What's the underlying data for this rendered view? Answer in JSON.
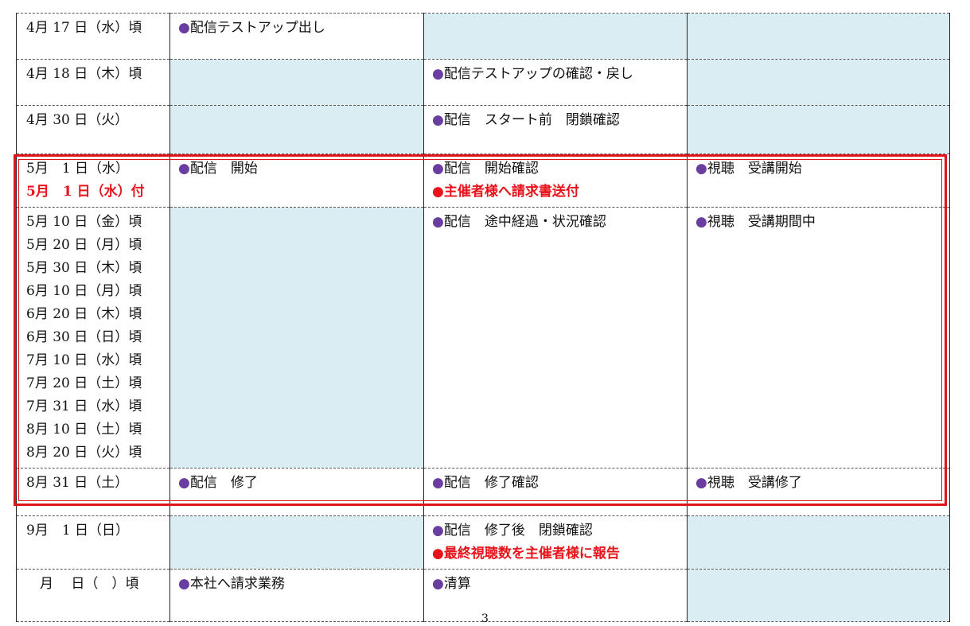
{
  "bullet_glyph": "●",
  "rows": [
    {
      "date": [
        "4月 17 日（水）頃"
      ],
      "c1": [
        {
          "t": "配信テストアップ出し"
        }
      ],
      "c2": [],
      "c3": [],
      "shade": [
        false,
        true,
        true
      ]
    },
    {
      "date": [
        "4月 18 日（木）頃"
      ],
      "c1": [],
      "c2": [
        {
          "t": "配信テストアップの確認・戻し"
        }
      ],
      "c3": [],
      "shade": [
        true,
        false,
        true
      ]
    },
    {
      "date": [
        "4月 30 日（火）"
      ],
      "c1": [],
      "c2": [
        {
          "t": "配信　スタート前　閉鎖確認"
        }
      ],
      "c3": [],
      "shade": [
        true,
        false,
        true
      ]
    },
    {
      "date": [
        "5月　1 日（水）",
        {
          "t": "5月　1 日（水）付",
          "red": true
        }
      ],
      "c1": [
        {
          "t": "配信　開始"
        }
      ],
      "c2": [
        {
          "t": "配信　開始確認"
        },
        {
          "t": "主催者様へ請求書送付",
          "red": true
        }
      ],
      "c3": [
        {
          "t": "視聴　受講開始"
        }
      ],
      "shade": [
        false,
        false,
        false
      ]
    },
    {
      "date": [
        "5月 10 日（金）頃",
        "5月 20 日（月）頃",
        "5月 30 日（木）頃",
        "6月 10 日（月）頃",
        "6月 20 日（木）頃",
        "6月 30 日（日）頃",
        "7月 10 日（水）頃",
        "7月 20 日（土）頃",
        "7月 31 日（水）頃",
        "8月 10 日（土）頃",
        "8月 20 日（火）頃"
      ],
      "c1": [],
      "c2": [
        {
          "t": "配信　途中経過・状況確認"
        }
      ],
      "c3": [
        {
          "t": "視聴　受講期間中"
        }
      ],
      "shade": [
        true,
        false,
        false
      ]
    },
    {
      "date": [
        "8月 31 日（土）"
      ],
      "c1": [
        {
          "t": "配信　修了"
        }
      ],
      "c2": [
        {
          "t": "配信　修了確認"
        }
      ],
      "c3": [
        {
          "t": "視聴　受講修了"
        }
      ],
      "shade": [
        false,
        false,
        false
      ]
    },
    {
      "date": [
        "9月　1 日（日）"
      ],
      "c1": [],
      "c2": [
        {
          "t": "配信　修了後　閉鎖確認"
        },
        {
          "t": "最終視聴数を主催者様に報告",
          "red": true
        }
      ],
      "c3": [],
      "shade": [
        true,
        false,
        true
      ]
    },
    {
      "date": [
        "　月　 日（　）頃"
      ],
      "c1": [
        {
          "t": "本社へ請求業務"
        }
      ],
      "c2": [
        {
          "t": "清算"
        }
      ],
      "c3": [],
      "shade": [
        false,
        false,
        true
      ]
    }
  ],
  "page_number": "3"
}
